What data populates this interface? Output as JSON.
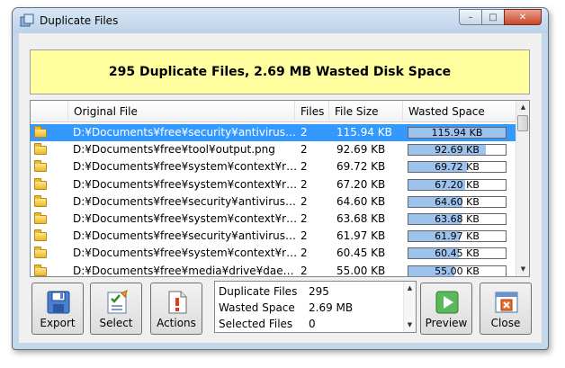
{
  "window": {
    "title": "Duplicate Files",
    "minimize_glyph": "–",
    "maximize_glyph": "□",
    "close_glyph": "✕"
  },
  "summary": "295 Duplicate Files, 2.69 MB Wasted Disk Space",
  "table": {
    "columns": [
      "Original File",
      "Files",
      "File Size",
      "Wasted Space"
    ],
    "rows": [
      {
        "file": "D:¥Documents¥free¥security¥antivirus…",
        "files": "2",
        "size": "115.94 KB",
        "wasted": "115.94 KB",
        "fill": 1.0,
        "selected": true
      },
      {
        "file": "D:¥Documents¥free¥tool¥output.png",
        "files": "2",
        "size": "92.69 KB",
        "wasted": "92.69 KB",
        "fill": 0.8,
        "selected": false
      },
      {
        "file": "D:¥Documents¥free¥system¥context¥r…",
        "files": "2",
        "size": "69.72 KB",
        "wasted": "69.72 KB",
        "fill": 0.6,
        "selected": false
      },
      {
        "file": "D:¥Documents¥free¥system¥context¥r…",
        "files": "2",
        "size": "67.20 KB",
        "wasted": "67.20 KB",
        "fill": 0.58,
        "selected": false
      },
      {
        "file": "D:¥Documents¥free¥security¥antivirus…",
        "files": "2",
        "size": "64.60 KB",
        "wasted": "64.60 KB",
        "fill": 0.56,
        "selected": false
      },
      {
        "file": "D:¥Documents¥free¥system¥context¥r…",
        "files": "2",
        "size": "63.68 KB",
        "wasted": "63.68 KB",
        "fill": 0.55,
        "selected": false
      },
      {
        "file": "D:¥Documents¥free¥security¥antivirus…",
        "files": "2",
        "size": "61.97 KB",
        "wasted": "61.97 KB",
        "fill": 0.53,
        "selected": false
      },
      {
        "file": "D:¥Documents¥free¥system¥context¥r…",
        "files": "2",
        "size": "60.45 KB",
        "wasted": "60.45 KB",
        "fill": 0.52,
        "selected": false
      },
      {
        "file": "D:¥Documents¥free¥media¥drive¥dae…",
        "files": "2",
        "size": "55.00 KB",
        "wasted": "55.00 KB",
        "fill": 0.47,
        "selected": false
      }
    ],
    "row_icon": "folder-icon",
    "scroll_up_glyph": "▲",
    "scroll_down_glyph": "▼"
  },
  "buttons": {
    "export": "Export",
    "select": "Select",
    "actions": "Actions",
    "preview": "Preview",
    "close": "Close"
  },
  "stats": [
    {
      "label": "Duplicate Files",
      "value": "295"
    },
    {
      "label": "Wasted Space",
      "value": "2.69 MB"
    },
    {
      "label": "Selected Files",
      "value": "0"
    }
  ],
  "colors": {
    "summary_bg": "#ffffa0",
    "selection": "#3399ff",
    "bar_fill": "#9ec2ee"
  }
}
